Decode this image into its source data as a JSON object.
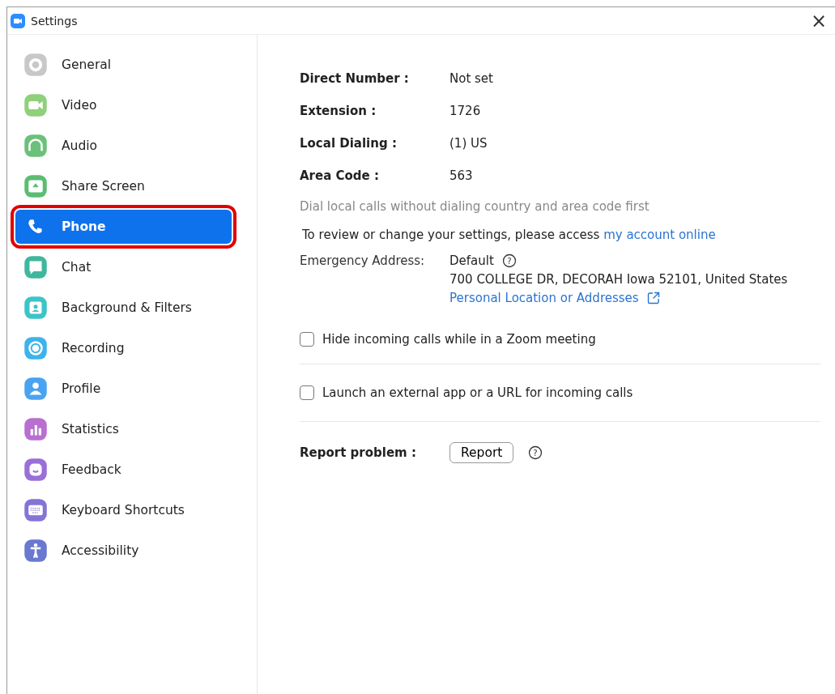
{
  "window": {
    "title": "Settings",
    "close": "×"
  },
  "sidebar": {
    "items": [
      {
        "label": "General",
        "selected": false,
        "highlighted": false,
        "color": "#c8c8c8"
      },
      {
        "label": "Video",
        "selected": false,
        "highlighted": false,
        "color": "#8fd07a"
      },
      {
        "label": "Audio",
        "selected": false,
        "highlighted": false,
        "color": "#6cc17a"
      },
      {
        "label": "Share Screen",
        "selected": false,
        "highlighted": false,
        "color": "#5bbd72"
      },
      {
        "label": "Phone",
        "selected": true,
        "highlighted": true,
        "color": "#ffffff"
      },
      {
        "label": "Chat",
        "selected": false,
        "highlighted": false,
        "color": "#3fb79e"
      },
      {
        "label": "Background & Filters",
        "selected": false,
        "highlighted": false,
        "color": "#3cc4c8"
      },
      {
        "label": "Recording",
        "selected": false,
        "highlighted": false,
        "color": "#3db3ea"
      },
      {
        "label": "Profile",
        "selected": false,
        "highlighted": false,
        "color": "#4aa3f0"
      },
      {
        "label": "Statistics",
        "selected": false,
        "highlighted": false,
        "color": "#b86fd0"
      },
      {
        "label": "Feedback",
        "selected": false,
        "highlighted": false,
        "color": "#9a6fd8"
      },
      {
        "label": "Keyboard Shortcuts",
        "selected": false,
        "highlighted": false,
        "color": "#8574d6"
      },
      {
        "label": "Accessibility",
        "selected": false,
        "highlighted": false,
        "color": "#6a78d0"
      }
    ]
  },
  "phone": {
    "fields": [
      {
        "label": "Direct Number :",
        "value": "Not set"
      },
      {
        "label": "Extension :",
        "value": "1726"
      },
      {
        "label": "Local Dialing :",
        "value": "(1) US"
      },
      {
        "label": "Area Code :",
        "value": "563"
      }
    ],
    "hint": "Dial local calls without dialing country and area code first",
    "review_text": "To review or change your settings, please access",
    "review_link": "my account online",
    "emergency": {
      "label": "Emergency Address:",
      "value": "Default",
      "help": "?",
      "address": "700 COLLEGE DR, DECORAH Iowa 52101, United States",
      "link": "Personal Location or Addresses"
    },
    "options": [
      {
        "label": "Hide incoming calls while in a Zoom meeting",
        "checked": false
      },
      {
        "label": "Launch an external app or a URL for incoming calls",
        "checked": false
      }
    ],
    "report": {
      "label": "Report problem :",
      "button": "Report",
      "help": "?"
    }
  }
}
